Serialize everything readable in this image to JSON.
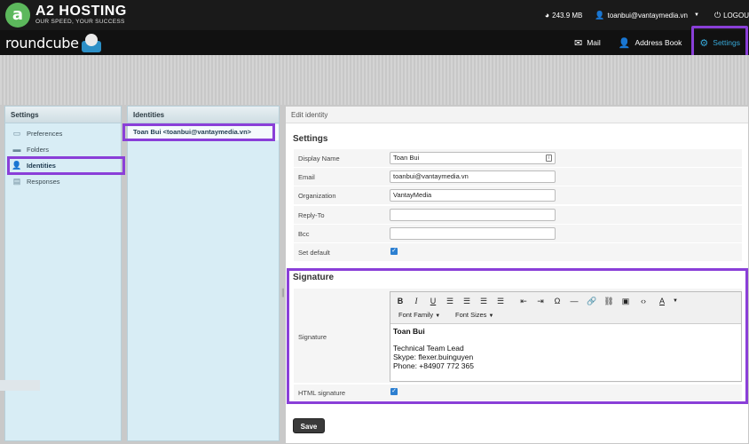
{
  "brand": {
    "logo_letter": "a",
    "name": "A2 HOSTING",
    "tagline": "OUR SPEED, YOUR SUCCESS"
  },
  "topbar": {
    "quota": "243.9 MB",
    "user": "toanbui@vantaymedia.vn",
    "logout": "LOGOU"
  },
  "roundcube": {
    "logo": "roundcube"
  },
  "nav": {
    "mail": "Mail",
    "address_book": "Address Book",
    "settings": "Settings"
  },
  "settings_panel": {
    "title": "Settings",
    "items": [
      {
        "label": "Preferences",
        "icon": "monitor-icon"
      },
      {
        "label": "Folders",
        "icon": "folder-icon"
      },
      {
        "label": "Identities",
        "icon": "person-icon"
      },
      {
        "label": "Responses",
        "icon": "response-icon"
      }
    ]
  },
  "identities_panel": {
    "title": "Identities",
    "rows": [
      "Toan Bui <toanbui@vantaymedia.vn>"
    ]
  },
  "edit": {
    "title": "Edit identity",
    "settings_section": "Settings",
    "fields": {
      "display_name": {
        "label": "Display Name",
        "value": "Toan Bui"
      },
      "email": {
        "label": "Email",
        "value": "toanbui@vantaymedia.vn"
      },
      "organization": {
        "label": "Organization",
        "value": "VantayMedia"
      },
      "reply_to": {
        "label": "Reply-To",
        "value": ""
      },
      "bcc": {
        "label": "Bcc",
        "value": ""
      },
      "set_default": {
        "label": "Set default",
        "checked": true
      }
    },
    "signature_section": "Signature",
    "signature_label": "Signature",
    "toolbar": {
      "font_family": "Font Family",
      "font_sizes": "Font Sizes"
    },
    "signature": {
      "name": "Toan Bui",
      "line1": "Technical Team Lead",
      "line2": "Skype: flexer.buinguyen",
      "line3": "Phone: +84907 772 365"
    },
    "html_signature": {
      "label": "HTML signature",
      "checked": true
    },
    "save": "Save"
  }
}
